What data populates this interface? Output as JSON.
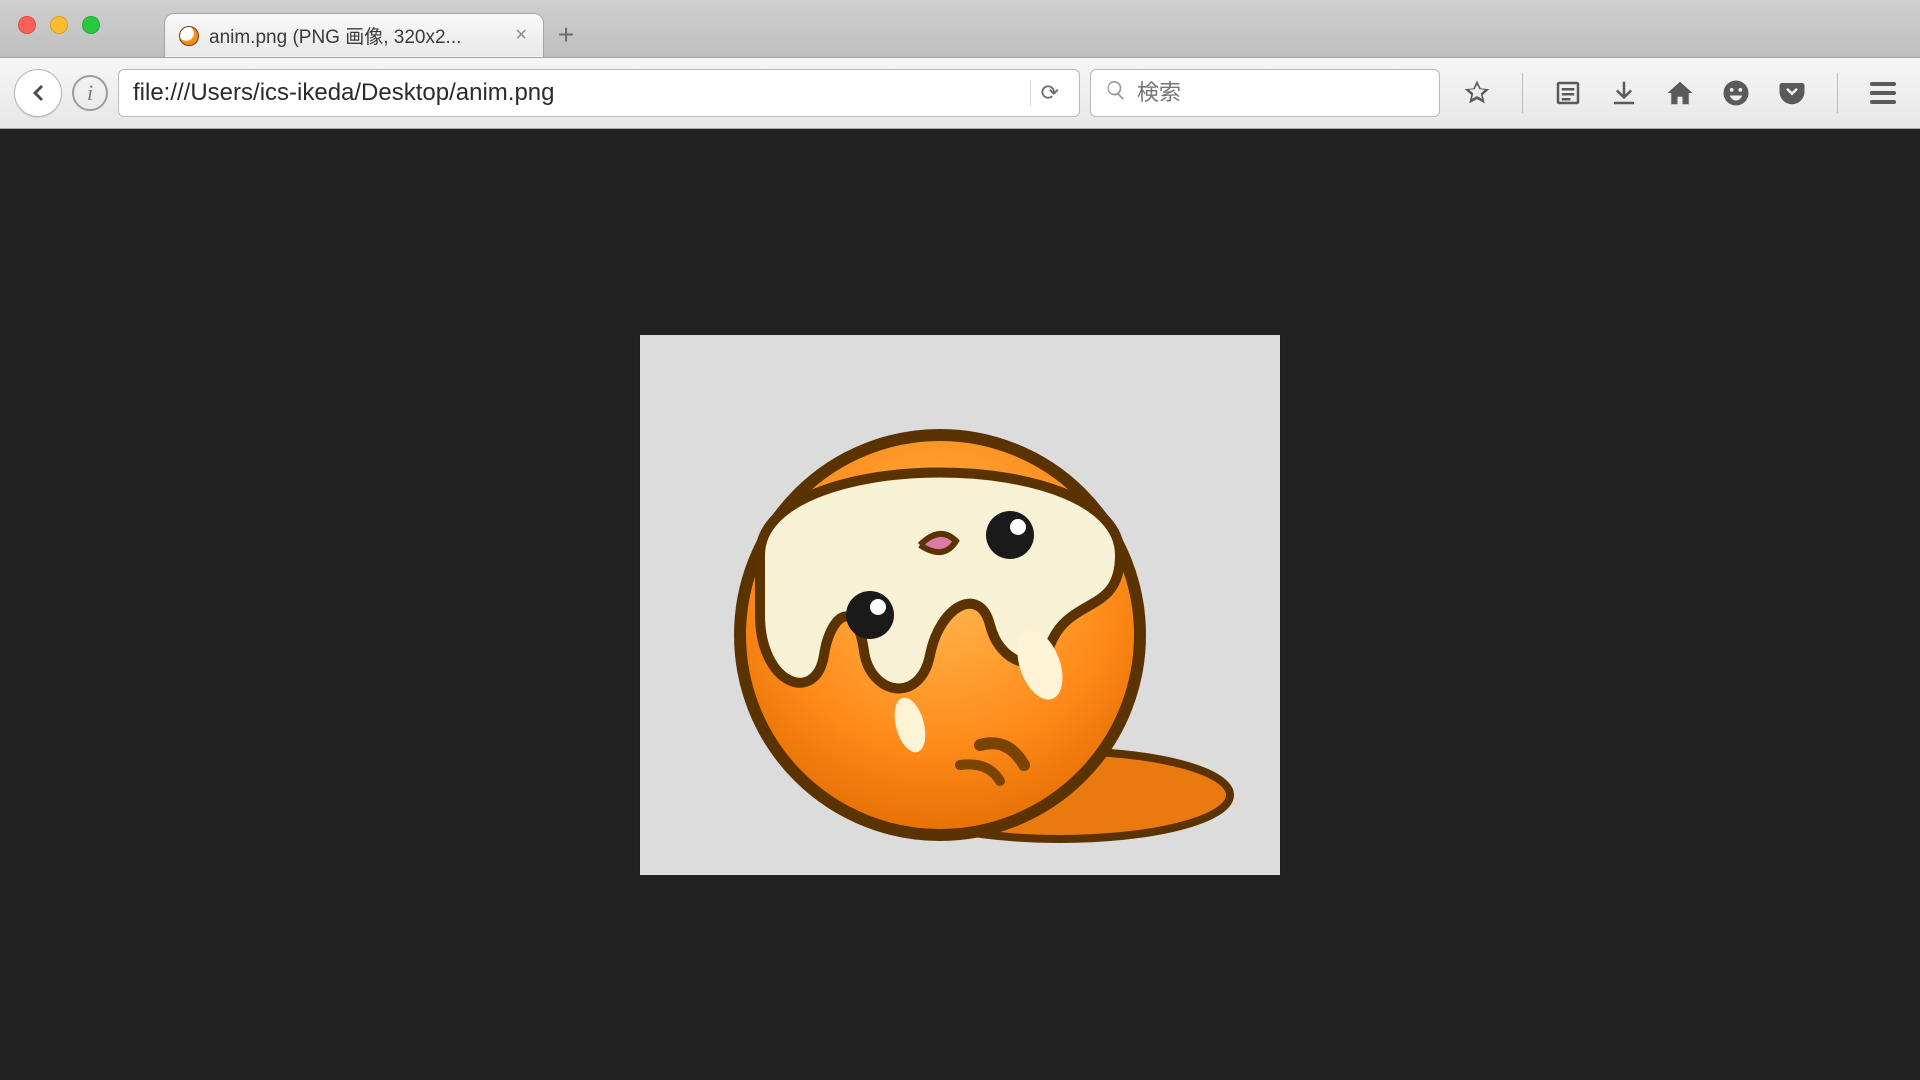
{
  "window": {
    "tab_title": "anim.png (PNG 画像, 320x2...",
    "close_glyph": "×",
    "newtab_glyph": "+"
  },
  "toolbar": {
    "back_glyph": "←",
    "identity_glyph": "i",
    "url": "file:///Users/ics-ikeda/Desktop/anim.png",
    "reload_glyph": "⟳",
    "search_placeholder": "検索",
    "icons": {
      "bookmark": "bookmark-star-icon",
      "reader": "reader-list-icon",
      "downloads": "downloads-icon",
      "home": "home-icon",
      "face": "smiley-icon",
      "pocket": "pocket-icon",
      "menu": "menu-icon"
    }
  },
  "content": {
    "image_name": "anim.png",
    "bg_color": "#222222",
    "image_bg": "#dcdcdc"
  }
}
